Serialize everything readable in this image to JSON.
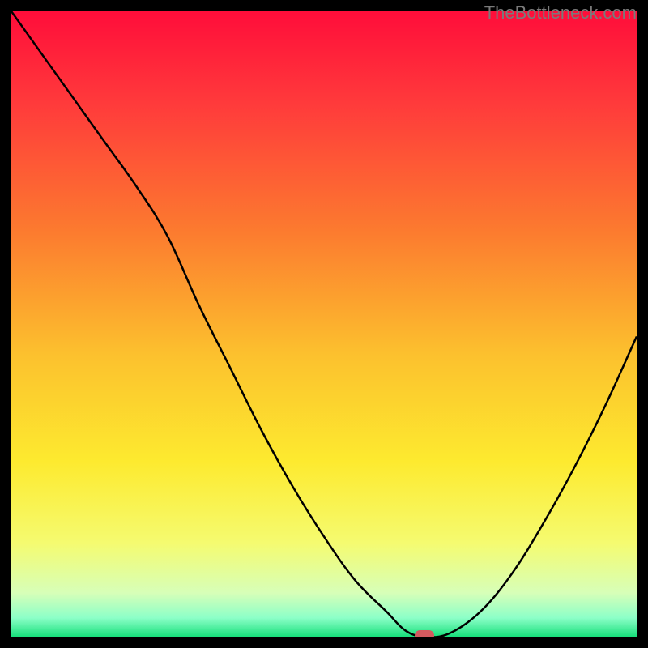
{
  "watermark": "TheBottleneck.com",
  "chart_data": {
    "type": "line",
    "title": "",
    "xlabel": "",
    "ylabel": "",
    "xlim": [
      0,
      100
    ],
    "ylim": [
      0,
      100
    ],
    "x": [
      0,
      5,
      10,
      15,
      20,
      25,
      30,
      35,
      40,
      45,
      50,
      55,
      60,
      63,
      66,
      70,
      75,
      80,
      85,
      90,
      95,
      100
    ],
    "values": [
      100,
      93,
      86,
      79,
      72,
      64,
      53,
      43,
      33,
      24,
      16,
      9,
      4,
      1,
      0,
      0.5,
      4,
      10,
      18,
      27,
      37,
      48
    ],
    "gradient_stops": [
      {
        "offset": 0.0,
        "color": "#ff0d3a"
      },
      {
        "offset": 0.15,
        "color": "#ff3b3b"
      },
      {
        "offset": 0.35,
        "color": "#fc7a2f"
      },
      {
        "offset": 0.55,
        "color": "#fcc12e"
      },
      {
        "offset": 0.72,
        "color": "#fdea2f"
      },
      {
        "offset": 0.85,
        "color": "#f5fb70"
      },
      {
        "offset": 0.93,
        "color": "#d7ffb8"
      },
      {
        "offset": 0.97,
        "color": "#8cffc8"
      },
      {
        "offset": 1.0,
        "color": "#18e07b"
      }
    ],
    "marker": {
      "x": 66,
      "y": 0,
      "color": "#d45a5f"
    }
  }
}
